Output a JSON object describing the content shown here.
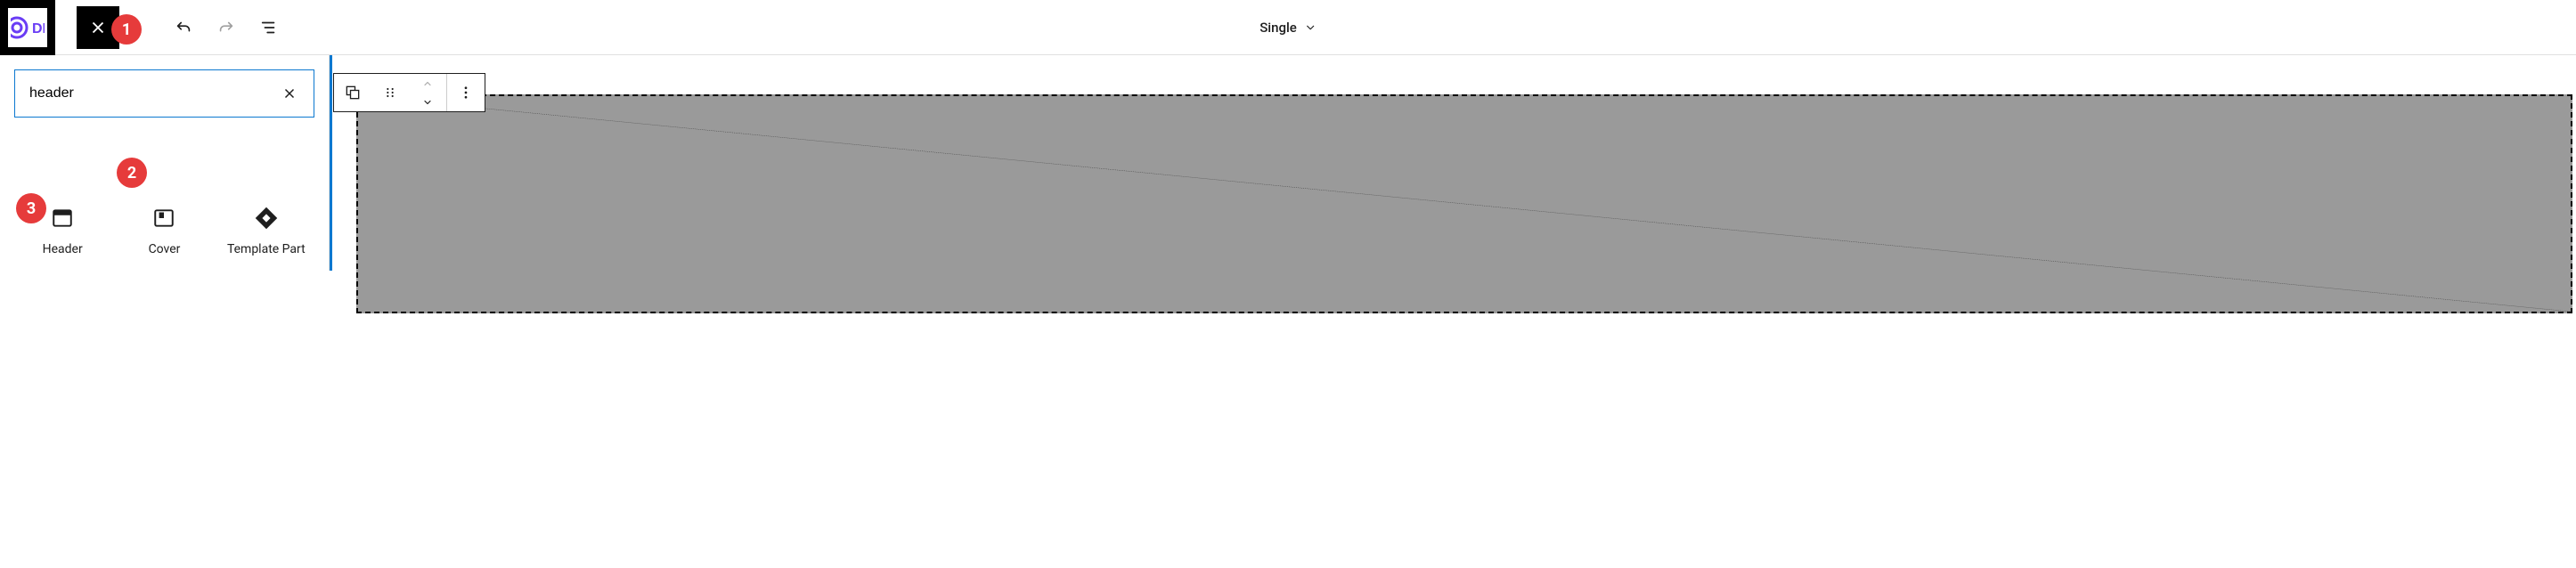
{
  "header": {
    "template_label": "Single"
  },
  "sidebar": {
    "search": {
      "value": "header"
    },
    "results": [
      {
        "label": "Header"
      },
      {
        "label": "Cover"
      },
      {
        "label": "Template Part"
      }
    ]
  },
  "steps": {
    "one": "1",
    "two": "2",
    "three": "3"
  }
}
